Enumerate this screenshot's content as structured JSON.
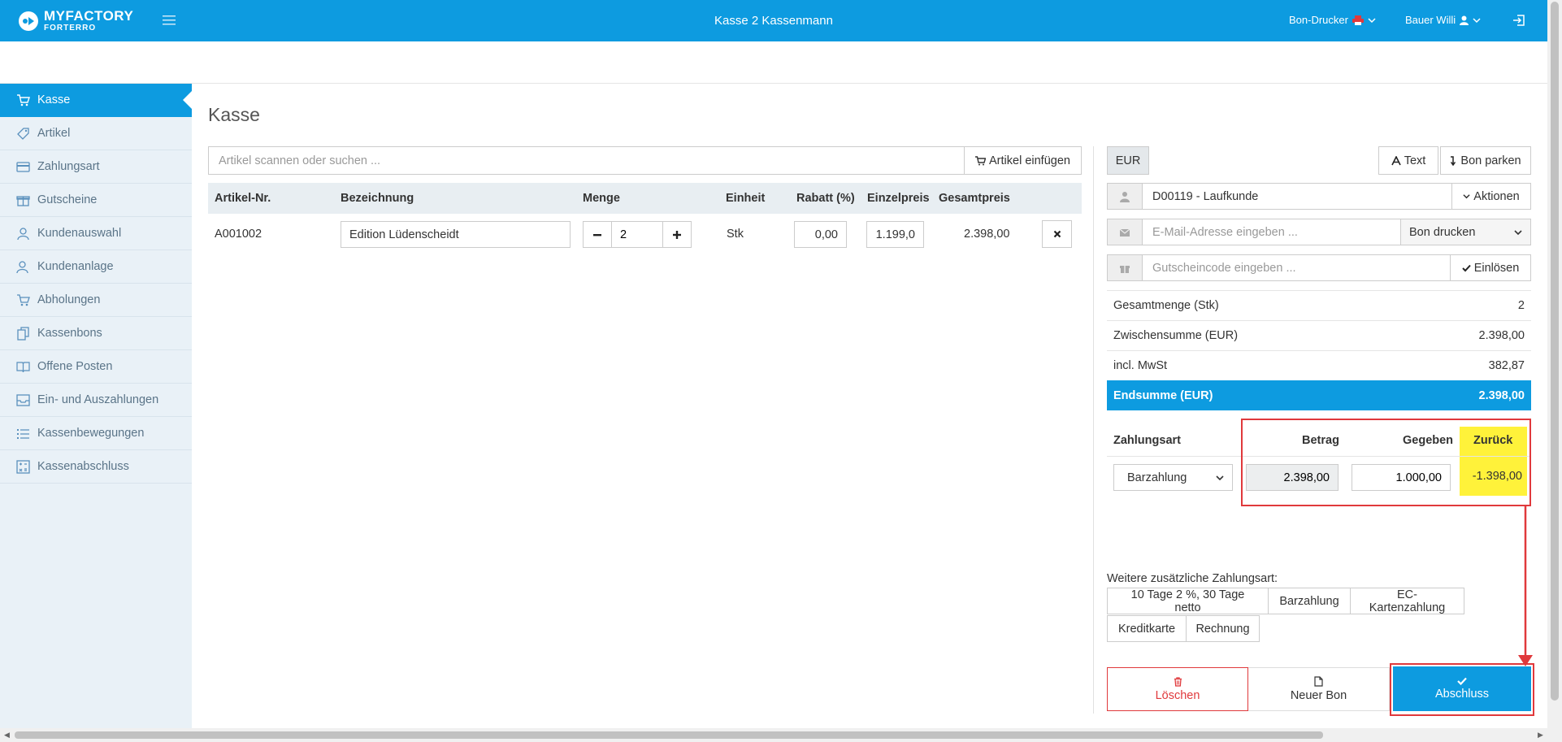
{
  "header": {
    "brand": "MYFACTORY",
    "brand_sub": "FORTERRO",
    "title": "Kasse 2 Kassenmann",
    "printer_label": "Bon-Drucker",
    "user_label": "Bauer Willi"
  },
  "sidebar": {
    "items": [
      {
        "label": "Kasse",
        "icon": "cart-icon",
        "active": true
      },
      {
        "label": "Artikel",
        "icon": "tag-icon"
      },
      {
        "label": "Zahlungsart",
        "icon": "credit-card-icon"
      },
      {
        "label": "Gutscheine",
        "icon": "gift-icon"
      },
      {
        "label": "Kundenauswahl",
        "icon": "user-icon"
      },
      {
        "label": "Kundenanlage",
        "icon": "user-add-icon"
      },
      {
        "label": "Abholungen",
        "icon": "cart-icon"
      },
      {
        "label": "Kassenbons",
        "icon": "copy-icon"
      },
      {
        "label": "Offene Posten",
        "icon": "book-icon"
      },
      {
        "label": "Ein- und Auszahlungen",
        "icon": "inbox-icon"
      },
      {
        "label": "Kassenbewegungen",
        "icon": "list-icon"
      },
      {
        "label": "Kassenabschluss",
        "icon": "calculator-icon"
      }
    ]
  },
  "main": {
    "title": "Kasse",
    "search_placeholder": "Artikel scannen oder suchen ...",
    "insert_button": "Artikel einfügen",
    "columns": {
      "artikel_nr": "Artikel-Nr.",
      "bezeichnung": "Bezeichnung",
      "menge": "Menge",
      "einheit": "Einheit",
      "rabatt": "Rabatt (%)",
      "einzelpreis": "Einzelpreis",
      "gesamtpreis": "Gesamtpreis"
    },
    "row": {
      "artikel_nr": "A001002",
      "bezeichnung": "Edition Lüdenscheidt",
      "menge": "2",
      "einheit": "Stk",
      "rabatt": "0,00",
      "einzelpreis": "1.199,0",
      "gesamtpreis": "2.398,00"
    }
  },
  "panel": {
    "currency": "EUR",
    "text_button": "Text",
    "park_button": "Bon parken",
    "customer": "D00119 - Laufkunde",
    "actions_button": "Aktionen",
    "email_placeholder": "E-Mail-Adresse eingeben ...",
    "print_select": "Bon drucken",
    "voucher_placeholder": "Gutscheincode eingeben ...",
    "redeem_button": "Einlösen",
    "summary": {
      "qty_label": "Gesamtmenge (Stk)",
      "qty_value": "2",
      "subtotal_label": "Zwischensumme (EUR)",
      "subtotal_value": "2.398,00",
      "vat_label": "incl. MwSt",
      "vat_value": "382,87",
      "total_label": "Endsumme (EUR)",
      "total_value": "2.398,00"
    },
    "payment": {
      "col_type": "Zahlungsart",
      "col_amount": "Betrag",
      "col_given": "Gegeben",
      "col_back": "Zurück",
      "type": "Barzahlung",
      "amount": "2.398,00",
      "given": "1.000,00",
      "back": "-1.398,00"
    },
    "extra_label": "Weitere zusätzliche Zahlungsart:",
    "extra_methods": [
      "10 Tage 2 %, 30 Tage netto",
      "Barzahlung",
      "EC-Kartenzahlung",
      "Kreditkarte",
      "Rechnung"
    ],
    "delete_button": "Löschen",
    "new_button": "Neuer Bon",
    "close_button": "Abschluss"
  },
  "colors": {
    "primary": "#0d9be0",
    "danger": "#e0393c",
    "highlight": "#fff23a"
  }
}
